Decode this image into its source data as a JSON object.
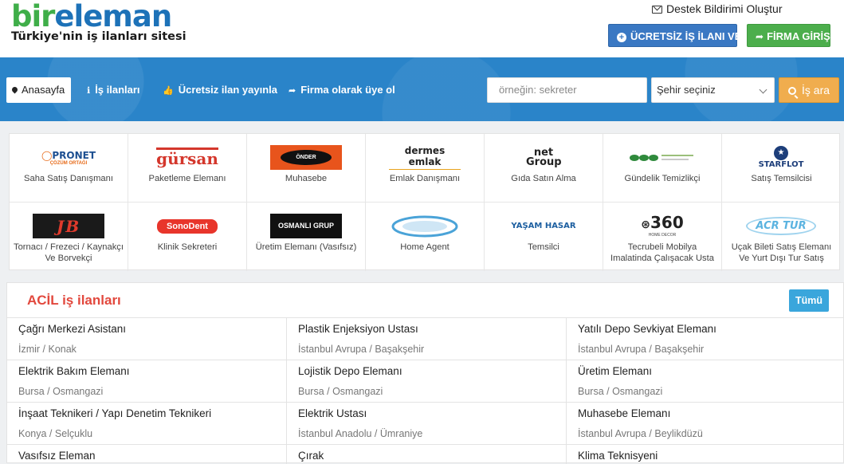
{
  "header": {
    "logo_part1": "bir",
    "logo_part2": "eleman",
    "tagline": "Türkiye'nin iş ilanları sitesi",
    "support_link": "Destek Bildirimi Oluştur",
    "free_job_button": "ÜCRETSİZ İŞ İLANI VER",
    "company_login_button": "FİRMA GİRİŞ"
  },
  "nav": {
    "home": "Anasayfa",
    "jobs": "İş ilanları",
    "free_post": "Ücretsiz ilan yayınla",
    "company_signup": "Firma olarak üye ol"
  },
  "search": {
    "placeholder": "örneğin: sekreter",
    "city_select": "Şehir seçiniz",
    "button": "İş ara"
  },
  "companies": [
    {
      "logo": "PRONET",
      "logo_sub": "ÇÖZÜM ORTAĞI",
      "caption": "Saha Satış Danışmanı"
    },
    {
      "logo": "gürsan",
      "caption": "Paketleme Elemanı"
    },
    {
      "logo": "ÖNDER",
      "caption": "Muhasebe"
    },
    {
      "logo": "dermes emlak",
      "caption": "Emlak Danışmanı"
    },
    {
      "logo": "net Group",
      "caption": "Gıda Satın Alma"
    },
    {
      "logo": "",
      "caption": "Gündelik Temizlikçi"
    },
    {
      "logo": "STARFLOT",
      "caption": "Satış Temsilcisi"
    },
    {
      "logo": "JB",
      "caption": "Tornacı / Frezeci / Kaynakçı Ve Borvekçi"
    },
    {
      "logo": "SonoDent",
      "caption": "Klinik Sekreteri"
    },
    {
      "logo": "OSMANLI GRUP",
      "caption": "Üretim Elemanı (Vasıfsız)"
    },
    {
      "logo": "",
      "caption": "Home Agent"
    },
    {
      "logo": "YAŞAM HASAR",
      "caption": "Temsilci"
    },
    {
      "logo": "360",
      "logo_sub": "HOME DECOR",
      "caption": "Tecrubeli Mobilya Imalatinda Çalışacak Usta"
    },
    {
      "logo": "ACR TUR",
      "caption": "Uçak Bileti Satış Elemanı Ve Yurt Dışı Tur Satış"
    }
  ],
  "urgent": {
    "title": "ACİL iş ilanları",
    "all_button": "Tümü",
    "jobs": [
      {
        "title": "Çağrı Merkezi Asistanı",
        "location": "İzmir / Konak"
      },
      {
        "title": "Plastik Enjeksiyon Ustası",
        "location": "İstanbul Avrupa / Başakşehir"
      },
      {
        "title": "Yatılı Depo Sevkiyat Elemanı",
        "location": "İstanbul Avrupa / Başakşehir"
      },
      {
        "title": "Elektrik Bakım Elemanı",
        "location": "Bursa / Osmangazi"
      },
      {
        "title": "Lojistik Depo Elemanı",
        "location": "Bursa / Osmangazi"
      },
      {
        "title": "Üretim Elemanı",
        "location": "Bursa / Osmangazi"
      },
      {
        "title": "İnşaat Teknikeri / Yapı Denetim Teknikeri",
        "location": "Konya / Selçuklu"
      },
      {
        "title": "Elektrik Ustası",
        "location": "İstanbul Anadolu / Ümraniye"
      },
      {
        "title": "Muhasebe Elemanı",
        "location": "İstanbul Avrupa / Beylikdüzü"
      },
      {
        "title": "Vasıfsız Eleman",
        "location": ""
      },
      {
        "title": "Çırak",
        "location": ""
      },
      {
        "title": "Klima Teknisyeni",
        "location": ""
      }
    ]
  },
  "colors": {
    "brand_blue": "#1d72b8",
    "brand_green": "#3fae49",
    "hero_blue": "#2a84c9",
    "accent_orange": "#f0ad4e",
    "urgent_red": "#e2483d"
  }
}
